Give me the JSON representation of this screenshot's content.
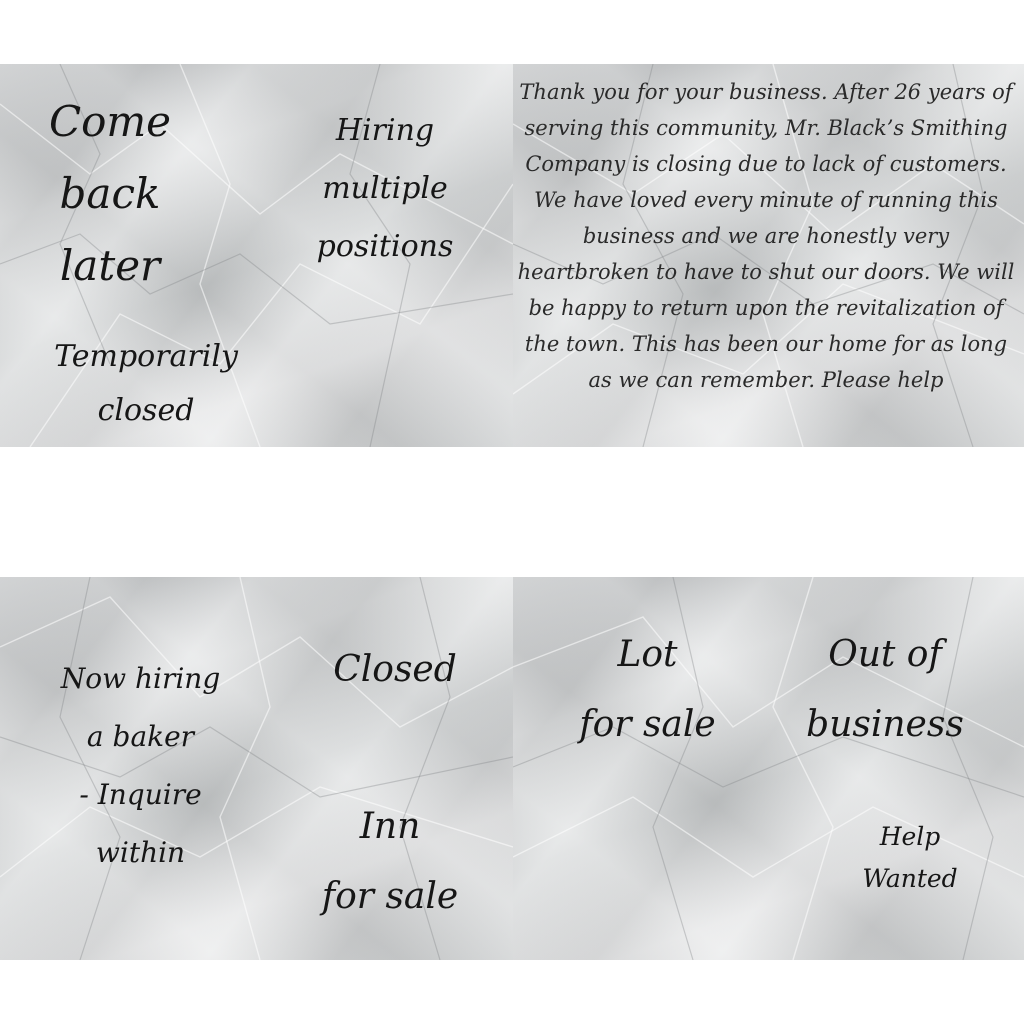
{
  "notices": {
    "come_back_later": "Come\nback\nlater",
    "hiring_multiple": "Hiring\nmultiple\npositions",
    "temporarily_closed": "Temporarily\nclosed",
    "smithing_letter": "Thank you for your business. After 26 years of serving this community, Mr. Black’s Smithing Company is closing due to lack of customers. We have loved every minute of running this business and we are honestly very heartbroken to have to shut our doors. We will be happy to return upon the revitalization of the town. This has been our home for as long as we can remember. Please help",
    "now_hiring_baker": "Now hiring\na baker\n- Inquire\nwithin",
    "closed": "Closed",
    "inn_for_sale": "Inn\nfor sale",
    "lot_for_sale": "Lot\nfor sale",
    "out_of_business": "Out of\nbusiness",
    "help_wanted": "Help\nWanted"
  },
  "colors": {
    "ink": "#161616",
    "paper_light": "#e6e7e8",
    "paper_dark": "#b6b9bb",
    "background": "#ffffff"
  }
}
